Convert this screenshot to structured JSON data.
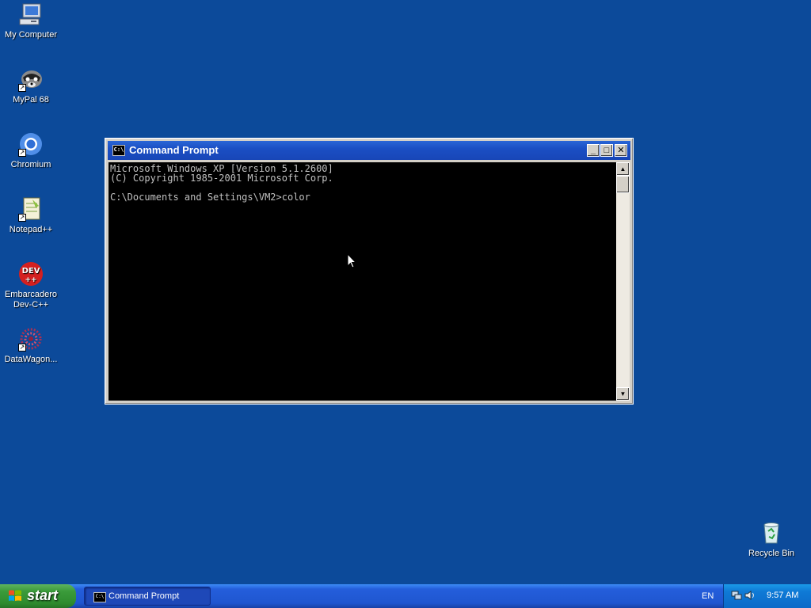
{
  "desktop": {
    "icons": [
      {
        "label": "My Computer"
      },
      {
        "label": "MyPal 68"
      },
      {
        "label": "Chromium"
      },
      {
        "label": "Notepad++"
      },
      {
        "label": "Embarcadero Dev-C++"
      },
      {
        "label": "DataWagon..."
      },
      {
        "label": "Recycle Bin"
      }
    ]
  },
  "window": {
    "title": "Command Prompt",
    "icon_text": "C:\\",
    "console_text": "Microsoft Windows XP [Version 5.1.2600]\n(C) Copyright 1985-2001 Microsoft Corp.\n\nC:\\Documents and Settings\\VM2>color",
    "buttons": {
      "minimize": "_",
      "maximize": "□",
      "close": "✕"
    }
  },
  "taskbar": {
    "start_label": "start",
    "tasks": [
      {
        "label": "Command Prompt"
      }
    ],
    "language": "EN",
    "clock": "9:57 AM"
  },
  "colors": {
    "desktop": "#0c4a9a",
    "titlebar": "#1b4fc4",
    "console_bg": "#000000",
    "console_fg": "#c0c0c0"
  }
}
